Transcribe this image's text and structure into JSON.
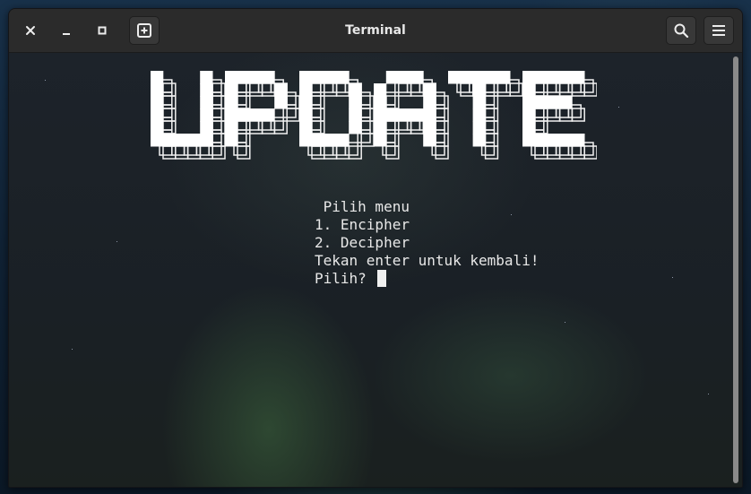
{
  "window": {
    "title": "Terminal"
  },
  "titlebar": {
    "close_icon": "close-icon",
    "minimize_icon": "minimize-icon",
    "maximize_icon": "maximize-icon",
    "new_tab_icon": "new-tab-icon",
    "search_icon": "search-icon",
    "menu_icon": "hamburger-menu-icon"
  },
  "terminal": {
    "banner_text": "UPDATE",
    "lines": [
      " Pilih menu",
      "1. Encipher",
      "2. Decipher",
      "Tekan enter untuk kembali!",
      "Pilih? "
    ]
  },
  "colors": {
    "titlebar_bg": "#2b2b2b",
    "text": "#e8e8e8"
  }
}
